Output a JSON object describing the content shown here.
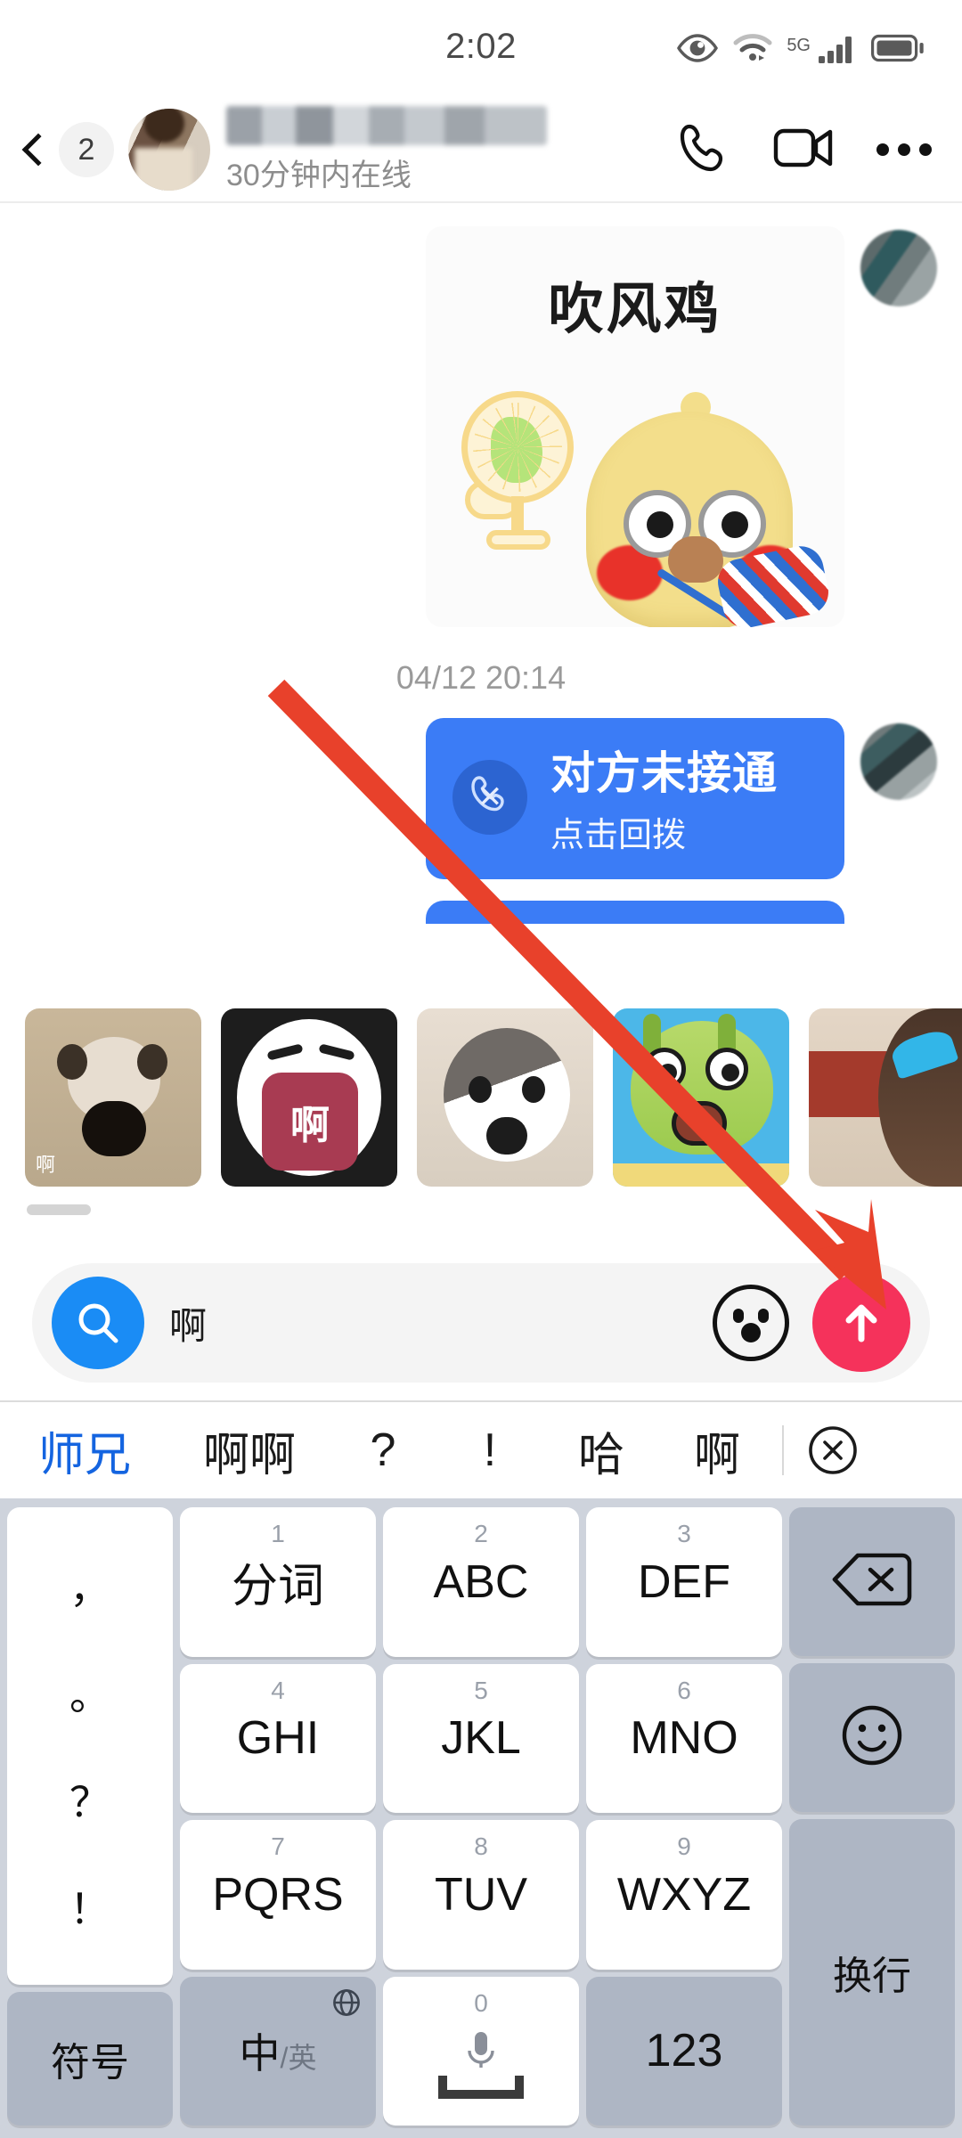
{
  "status_bar": {
    "time": "2:02",
    "network_label": "5G",
    "icons": [
      "eye-icon",
      "wifi-icon",
      "signal-icon",
      "battery-icon"
    ]
  },
  "header": {
    "back_badge": "2",
    "contact_name": "",
    "presence": "30分钟内在线",
    "actions": [
      "phone-call-icon",
      "video-call-icon",
      "more-options-icon"
    ]
  },
  "chat": {
    "sticker_message": {
      "caption": "吹风鸡"
    },
    "timestamp": "04/12 20:14",
    "call_bubble": {
      "title": "对方未接通",
      "subtitle": "点击回拨",
      "accent_color": "#3b7cf6"
    }
  },
  "sticker_suggestions": {
    "items": [
      {
        "name": "hamster-sticker",
        "caption": "啊"
      },
      {
        "name": "cartoon-scream-sticker",
        "caption": "啊"
      },
      {
        "name": "cat-shock-sticker",
        "caption": ""
      },
      {
        "name": "green-fish-sticker",
        "caption": ""
      },
      {
        "name": "girl-sticker",
        "caption": ""
      }
    ]
  },
  "input_bar": {
    "search_icon": "search-icon",
    "text": "啊",
    "placeholder": "",
    "emoji_icon": "emoji-face-icon",
    "send_icon": "send-arrow-up-icon",
    "send_color": "#f5325b",
    "search_color": "#1a8cf5"
  },
  "candidate_bar": {
    "items": [
      "师兄",
      "啊啊",
      "?",
      "!",
      "哈",
      "啊"
    ],
    "selected_index": 0,
    "selected_color": "#1464e0",
    "close_icon": "close-circle-icon"
  },
  "keyboard": {
    "punct_key": {
      "name": "punctuation-key",
      "chars": [
        "，",
        "。",
        "？",
        "！"
      ]
    },
    "rows": [
      [
        {
          "num": "1",
          "label": "分词",
          "type": "letter"
        },
        {
          "num": "2",
          "label": "ABC",
          "type": "letter"
        },
        {
          "num": "3",
          "label": "DEF",
          "type": "letter"
        }
      ],
      [
        {
          "num": "4",
          "label": "GHI",
          "type": "letter"
        },
        {
          "num": "5",
          "label": "JKL",
          "type": "letter"
        },
        {
          "num": "6",
          "label": "MNO",
          "type": "letter"
        }
      ],
      [
        {
          "num": "7",
          "label": "PQRS",
          "type": "letter"
        },
        {
          "num": "8",
          "label": "TUV",
          "type": "letter"
        },
        {
          "num": "9",
          "label": "WXYZ",
          "type": "letter"
        }
      ]
    ],
    "bottom_row": [
      {
        "label": "符号",
        "name": "symbols-key",
        "type": "fn"
      },
      {
        "label": "中",
        "sub": "/英",
        "name": "language-toggle-key",
        "type": "fn",
        "icon": "globe-icon"
      },
      {
        "label": "0",
        "name": "space-key",
        "type": "space",
        "icon": "microphone-icon"
      },
      {
        "label": "123",
        "name": "numeric-key",
        "type": "fn"
      }
    ],
    "right_column": [
      {
        "name": "backspace-key",
        "icon": "backspace-icon"
      },
      {
        "name": "emoji-key",
        "icon": "smiley-icon"
      },
      {
        "name": "enter-key",
        "label": "换行"
      }
    ]
  },
  "annotation": {
    "arrow_color": "#e8412b",
    "arrow_description": "red-arrow-pointing-to-send-button"
  }
}
